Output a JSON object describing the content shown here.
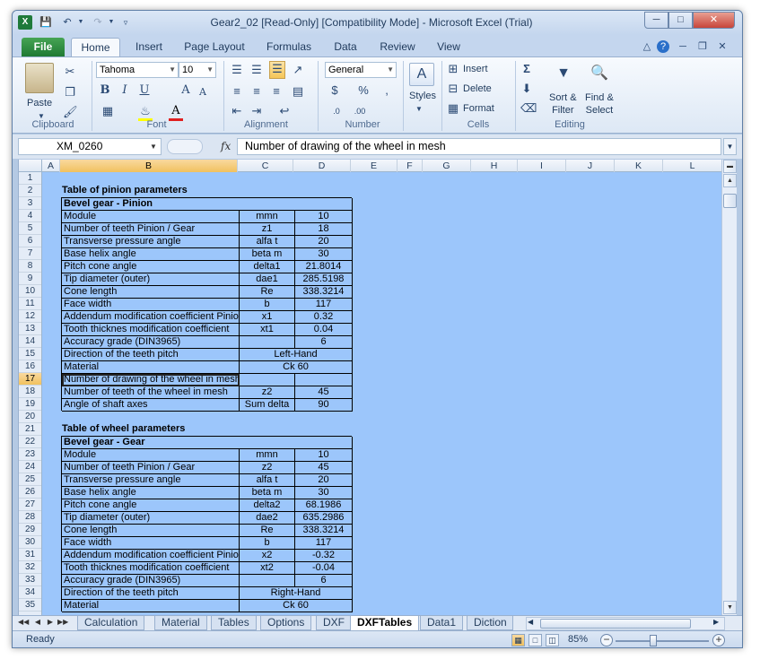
{
  "window": {
    "title": "Gear2_02  [Read-Only]  [Compatibility Mode]  -  Microsoft Excel (Trial)"
  },
  "tabs": [
    "File",
    "Home",
    "Insert",
    "Page Layout",
    "Formulas",
    "Data",
    "Review",
    "View"
  ],
  "ribbon": {
    "clipboard": {
      "label": "Clipboard",
      "paste": "Paste"
    },
    "font": {
      "label": "Font",
      "name": "Tahoma",
      "size": "10"
    },
    "alignment": {
      "label": "Alignment"
    },
    "number": {
      "label": "Number",
      "format": "General"
    },
    "styles": {
      "label": "Styles"
    },
    "cells": {
      "label": "Cells",
      "insert": "Insert",
      "delete": "Delete",
      "format": "Format"
    },
    "editing": {
      "label": "Editing",
      "sort_filter": "Sort &\nFilter",
      "find_select": "Find &\nSelect"
    }
  },
  "formula_bar": {
    "name_box": "XM_0260",
    "fx": "fx",
    "formula": "Number of drawing of the wheel in mesh"
  },
  "columns": [
    "A",
    "B",
    "C",
    "D",
    "E",
    "F",
    "G",
    "H",
    "I",
    "J",
    "K",
    "L"
  ],
  "rows": [
    "1",
    "2",
    "3",
    "4",
    "5",
    "6",
    "7",
    "8",
    "9",
    "10",
    "11",
    "12",
    "13",
    "14",
    "15",
    "16",
    "17",
    "18",
    "19",
    "20",
    "21",
    "22",
    "23",
    "24",
    "25",
    "26",
    "27",
    "28",
    "29",
    "30",
    "31",
    "32",
    "33",
    "34",
    "35"
  ],
  "pinion": {
    "title": "Table of pinion parameters",
    "header": "Bevel gear - Pinion",
    "rows": [
      [
        "Module",
        "mmn",
        "10"
      ],
      [
        "Number of teeth Pinion / Gear",
        "z1",
        "18"
      ],
      [
        "Transverse pressure angle",
        "alfa t",
        "20"
      ],
      [
        "Base helix angle",
        "beta m",
        "30"
      ],
      [
        "Pitch cone angle",
        "delta1",
        "21.8014"
      ],
      [
        "Tip diameter (outer)",
        "dae1",
        "285.5198"
      ],
      [
        "Cone length",
        "Re",
        "338.3214"
      ],
      [
        "Face width",
        "b",
        "117"
      ],
      [
        "Addendum modification coefficient Pinion",
        "x1",
        "0.32"
      ],
      [
        "Tooth thicknes modification coefficient",
        "xt1",
        "0.04"
      ],
      [
        "Accuracy grade (DIN3965)",
        "",
        "6"
      ],
      [
        "Direction of the teeth pitch",
        "Left-Hand"
      ],
      [
        "Material",
        "Ck 60"
      ],
      [
        "Number of drawing of the wheel in mesh",
        "",
        ""
      ],
      [
        "Number of teeth of the wheel in mesh",
        "z2",
        "45"
      ],
      [
        "Angle of shaft axes",
        "Sum delta",
        "90"
      ]
    ]
  },
  "gear": {
    "title": "Table of wheel parameters",
    "header": "Bevel gear - Gear",
    "rows": [
      [
        "Module",
        "mmn",
        "10"
      ],
      [
        "Number of teeth Pinion / Gear",
        "z2",
        "45"
      ],
      [
        "Transverse pressure angle",
        "alfa t",
        "20"
      ],
      [
        "Base helix angle",
        "beta m",
        "30"
      ],
      [
        "Pitch cone angle",
        "delta2",
        "68.1986"
      ],
      [
        "Tip diameter (outer)",
        "dae2",
        "635.2986"
      ],
      [
        "Cone length",
        "Re",
        "338.3214"
      ],
      [
        "Face width",
        "b",
        "117"
      ],
      [
        "Addendum modification coefficient Pinion",
        "x2",
        "-0.32"
      ],
      [
        "Tooth thicknes modification coefficient",
        "xt2",
        "-0.04"
      ],
      [
        "Accuracy grade (DIN3965)",
        "",
        "6"
      ],
      [
        "Direction of the teeth pitch",
        "Right-Hand"
      ],
      [
        "Material",
        "Ck 60"
      ]
    ]
  },
  "sheets": [
    "Calculation",
    "Material",
    "Tables",
    "Options",
    "DXF",
    "DXFTables",
    "Data1",
    "Diction"
  ],
  "active_sheet": "DXFTables",
  "status": {
    "text": "Ready",
    "zoom": "85%"
  }
}
